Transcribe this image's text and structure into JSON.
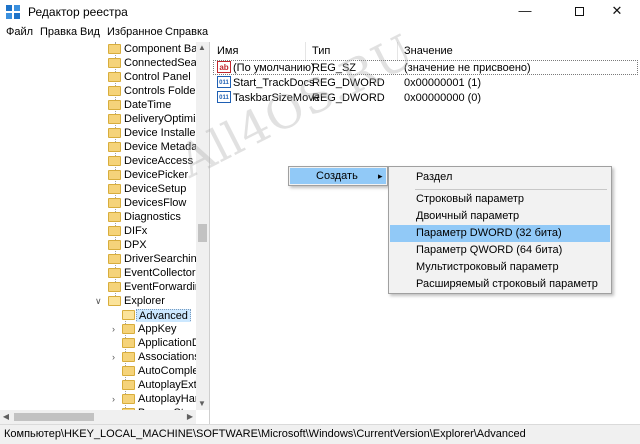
{
  "window": {
    "title": "Редактор реестра",
    "minimize_glyph": "—",
    "close_glyph": "✕"
  },
  "menu": [
    "Файл",
    "Правка",
    "Вид",
    "Избранное",
    "Справка"
  ],
  "tree": {
    "items": [
      "Component Base",
      "ConnectedSearch",
      "Control Panel",
      "Controls Folder",
      "DateTime",
      "DeliveryOptimizat",
      "Device Installer",
      "Device Metadata",
      "DeviceAccess",
      "DevicePicker",
      "DeviceSetup",
      "DevicesFlow",
      "Diagnostics",
      "DIFx",
      "DPX",
      "DriverSearching",
      "EventCollector",
      "EventForwarding",
      "Explorer"
    ],
    "children": [
      "Advanced",
      "AppKey",
      "ApplicationDe",
      "Associations",
      "AutoComplet",
      "AutoplayExter",
      "AutoplayHand",
      "BannerStore"
    ],
    "selected": "Advanced"
  },
  "list": {
    "columns": [
      "Имя",
      "Тип",
      "Значение"
    ],
    "rows": [
      {
        "name": "(По умолчанию)",
        "type": "REG_SZ",
        "value": "(значение не присвоено)",
        "icon": "ab"
      },
      {
        "name": "Start_TrackDocs",
        "type": "REG_DWORD",
        "value": "0x00000001 (1)",
        "icon": "011"
      },
      {
        "name": "TaskbarSizeMove",
        "type": "REG_DWORD",
        "value": "0x00000000 (0)",
        "icon": "011"
      }
    ]
  },
  "context_menu": {
    "label": "Создать",
    "submenu": [
      "Раздел",
      "Строковый параметр",
      "Двоичный параметр",
      "Параметр DWORD (32 бита)",
      "Параметр QWORD (64 бита)",
      "Мультистроковый параметр",
      "Расширяемый строковый параметр"
    ],
    "highlighted": "Параметр DWORD (32 бита)"
  },
  "watermark": "All4OS.RU",
  "status": "Компьютер\\HKEY_LOCAL_MACHINE\\SOFTWARE\\Microsoft\\Windows\\CurrentVersion\\Explorer\\Advanced",
  "colors": {
    "highlight": "#91c9f7",
    "selection": "#cce8ff",
    "folder": "#f5d37a"
  }
}
